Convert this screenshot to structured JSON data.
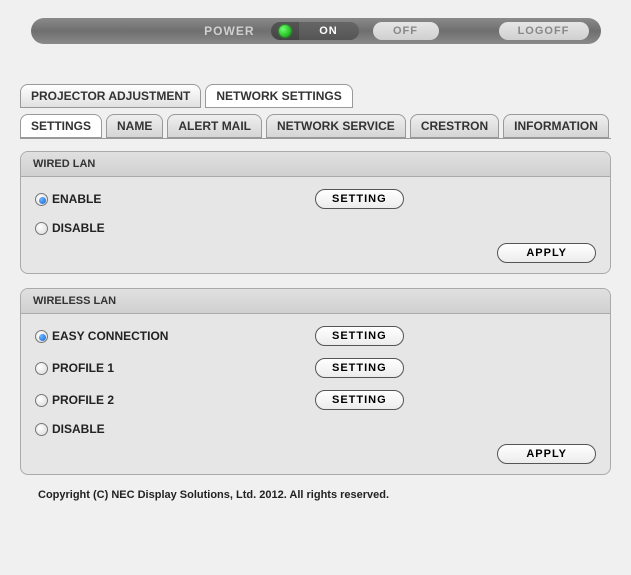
{
  "topbar": {
    "power_label": "POWER",
    "on_label": "ON",
    "off_label": "OFF",
    "logoff_label": "LOGOFF"
  },
  "tabs_outer": [
    {
      "label": "PROJECTOR ADJUSTMENT",
      "active": false
    },
    {
      "label": "NETWORK SETTINGS",
      "active": true
    }
  ],
  "tabs_inner": [
    {
      "label": "SETTINGS",
      "active": true
    },
    {
      "label": "NAME",
      "active": false
    },
    {
      "label": "ALERT MAIL",
      "active": false
    },
    {
      "label": "NETWORK SERVICE",
      "active": false
    },
    {
      "label": "CRESTRON",
      "active": false
    },
    {
      "label": "INFORMATION",
      "active": false
    }
  ],
  "wired": {
    "title": "WIRED LAN",
    "enable_label": "ENABLE",
    "disable_label": "DISABLE",
    "setting_label": "SETTING",
    "apply_label": "APPLY",
    "selected": "enable"
  },
  "wireless": {
    "title": "WIRELESS LAN",
    "easy_label": "EASY CONNECTION",
    "profile1_label": "PROFILE 1",
    "profile2_label": "PROFILE 2",
    "disable_label": "DISABLE",
    "setting_label": "SETTING",
    "apply_label": "APPLY",
    "selected": "easy"
  },
  "copyright": "Copyright (C) NEC Display Solutions, Ltd. 2012. All rights reserved."
}
